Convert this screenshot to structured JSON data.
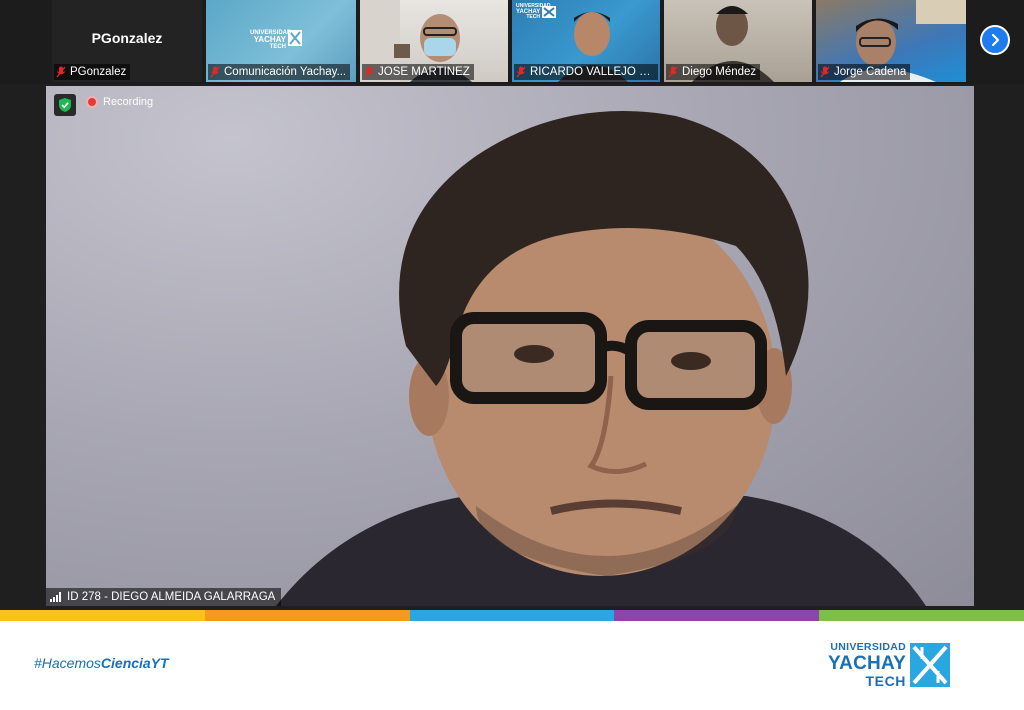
{
  "participants": [
    {
      "name": "PGonzalez",
      "tile_name": "PGonzalez",
      "muted": true
    },
    {
      "name": "Comunicación Yachay...",
      "muted": true
    },
    {
      "name": "JOSE MARTINEZ",
      "muted": true
    },
    {
      "name": "RICARDO VALLEJO Cl...",
      "muted": true
    },
    {
      "name": "Diego Méndez",
      "muted": true
    },
    {
      "name": "Jorge Cadena",
      "muted": true
    }
  ],
  "thumbnail_logo": {
    "line1": "UNIVERSIDAD",
    "line2": "YACHAY",
    "line3": "TECH"
  },
  "main_video": {
    "recording_label": "Recording",
    "speaker_label": "ID 278 - DIEGO ALMEIDA GALARRAGA"
  },
  "next_page_icon": "chevron-right-icon",
  "brand_colors": [
    "#f7c21a",
    "#f39a1f",
    "#2aa6e0",
    "#8b46a8",
    "#7cc04a"
  ],
  "footer": {
    "hashtag_prefix": "#Hacemos",
    "hashtag_bold": "CienciaYT",
    "logo_line1": "UNIVERSIDAD",
    "logo_line2": "YACHAY",
    "logo_line3": "TECH"
  }
}
